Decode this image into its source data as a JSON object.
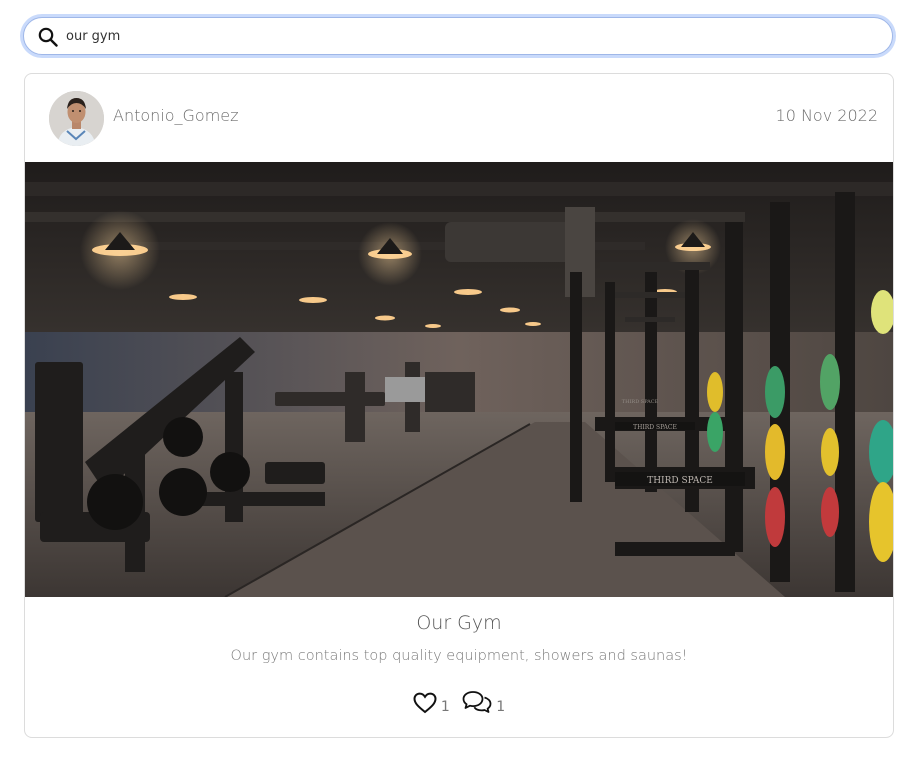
{
  "search": {
    "value": "our gym",
    "icon": "search-icon"
  },
  "post": {
    "username": "Antonio_Gomez",
    "date": "10 Nov 2022",
    "title": "Our Gym",
    "content": "Our gym contains top quality equipment, showers and saunas!",
    "image_signage": [
      "THIRD SPACE",
      "THIRD SPACE",
      "THIRD SPACE"
    ],
    "likes_count": "1",
    "comments_count": "1",
    "like_icon": "heart-icon",
    "comment_icon": "comments-icon"
  }
}
